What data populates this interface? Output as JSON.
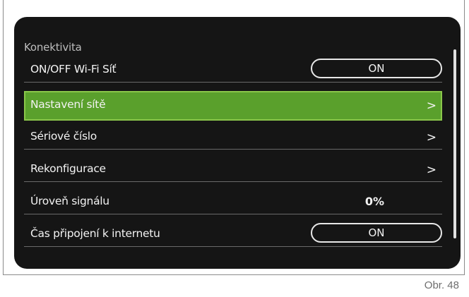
{
  "screen": {
    "title": "Konektivita",
    "rows": [
      {
        "label": "ON/OFF Wi-Fi Síť",
        "control": "toggle",
        "value": "ON"
      },
      {
        "label": "Nastavení sítě",
        "control": "arrow",
        "value": ">",
        "selected": true
      },
      {
        "label": "Sériové číslo",
        "control": "arrow",
        "value": ">"
      },
      {
        "label": "Rekonfigurace",
        "control": "arrow",
        "value": ">"
      },
      {
        "label": "Úroveň signálu",
        "control": "value",
        "value": "0%"
      },
      {
        "label": "Čas připojení k internetu",
        "control": "toggle",
        "value": "ON"
      }
    ]
  },
  "caption": "Obr. 48",
  "colors": {
    "screen_background": "#151515",
    "selected_background": "#5aa02c",
    "selected_border": "#8ac64a",
    "text": "#f2f2f2",
    "title_text": "#bdbdbd"
  }
}
